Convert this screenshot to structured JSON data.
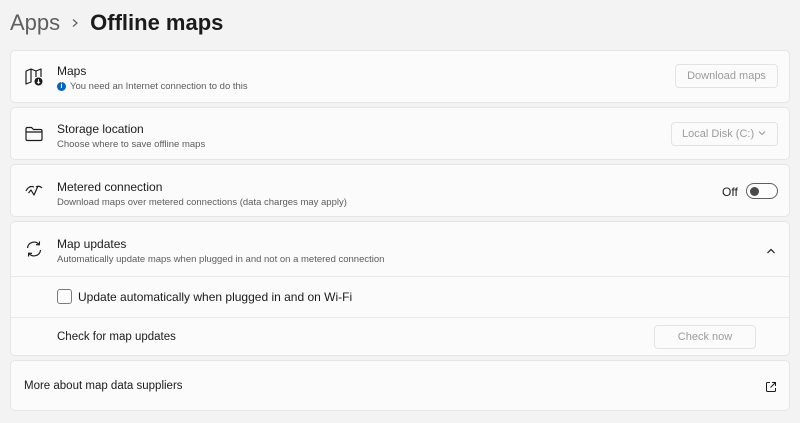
{
  "breadcrumb": {
    "parent": "Apps",
    "current": "Offline maps"
  },
  "maps": {
    "title": "Maps",
    "subtitle": "You need an Internet connection to do this",
    "button": "Download maps"
  },
  "storage": {
    "title": "Storage location",
    "subtitle": "Choose where to save offline maps",
    "selected": "Local Disk (C:)"
  },
  "metered": {
    "title": "Metered connection",
    "subtitle": "Download maps over metered connections (data charges may apply)",
    "toggle_label": "Off",
    "toggle_on": false
  },
  "updates": {
    "title": "Map updates",
    "subtitle": "Automatically update maps when plugged in and not on a metered connection",
    "checkbox_label": "Update automatically when plugged in and on Wi-Fi",
    "checkbox_checked": false,
    "check_text": "Check for map updates",
    "check_button": "Check now"
  },
  "suppliers": {
    "text": "More about map data suppliers"
  },
  "icons": {
    "breadcrumb_separator": "chevron-right-icon",
    "maps": "map-download-icon",
    "info": "info-icon",
    "storage": "folder-icon",
    "metered": "metered-connection-icon",
    "updates": "sync-icon",
    "collapse": "chevron-up-icon",
    "external": "open-external-icon",
    "dropdown": "chevron-down-icon"
  },
  "colors": {
    "background": "#f3f3f3",
    "card": "#fbfbfb",
    "accent": "#0067c0",
    "text": "#1b1b1b",
    "muted": "#5c5c5c",
    "disabled": "#9b9b9b"
  }
}
